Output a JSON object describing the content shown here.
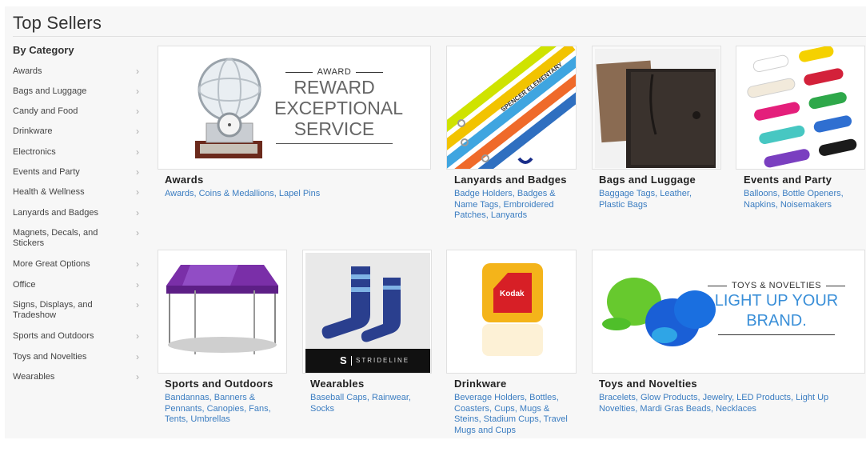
{
  "page": {
    "title": "Top Sellers"
  },
  "sidebar": {
    "heading": "By Category",
    "items": [
      {
        "label": "Awards"
      },
      {
        "label": "Bags and Luggage"
      },
      {
        "label": "Candy and Food"
      },
      {
        "label": "Drinkware"
      },
      {
        "label": "Electronics"
      },
      {
        "label": "Events and Party"
      },
      {
        "label": "Health & Wellness"
      },
      {
        "label": "Lanyards and Badges"
      },
      {
        "label": "Magnets, Decals, and Stickers"
      },
      {
        "label": "More Great Options"
      },
      {
        "label": "Office"
      },
      {
        "label": "Signs, Displays, and Tradeshow"
      },
      {
        "label": "Sports and Outdoors"
      },
      {
        "label": "Toys and Novelties"
      },
      {
        "label": "Wearables"
      }
    ],
    "chevron": "›"
  },
  "tiles": {
    "awards": {
      "title": "Awards",
      "links": "Awards, Coins & Medallions, Lapel Pins",
      "promo_kicker": "AWARD",
      "promo_line1": "REWARD",
      "promo_line2": "EXCEPTIONAL",
      "promo_line3": "SERVICE"
    },
    "lanyards": {
      "title": "Lanyards and Badges",
      "links": "Badge Holders, Badges & Name Tags, Embroidered Patches, Lanyards",
      "lanyard_text": "SPENCER ELEMENTARY"
    },
    "bags": {
      "title": "Bags and Luggage",
      "links": "Baggage Tags, Leather, Plastic Bags"
    },
    "events": {
      "title": "Events and Party",
      "links": "Balloons, Bottle Openers, Napkins, Noisemakers"
    },
    "sports": {
      "title": "Sports and Outdoors",
      "links": "Bandannas, Banners & Pennants, Canopies, Fans, Tents, Umbrellas"
    },
    "wearables": {
      "title": "Wearables",
      "links": "Baseball Caps, Rainwear, Socks",
      "brand_mark": "S",
      "brand_name": "STRIDELINE"
    },
    "drinkware": {
      "title": "Drinkware",
      "links": "Beverage Holders, Bottles, Coasters, Cups, Mugs & Steins, Stadium Cups, Travel Mugs and Cups",
      "logo_text": "Kodak"
    },
    "toys": {
      "title": "Toys and Novelties",
      "links": "Bracelets, Glow Products, Jewelry, LED Products, Light Up Novelties, Mardi Gras Beads, Necklaces",
      "promo_kicker": "TOYS & NOVELTIES",
      "promo_line1": "LIGHT UP YOUR",
      "promo_line2": "BRAND."
    }
  },
  "colors": {
    "link": "#3b7dc1",
    "toys_promo": "#3a8fd8",
    "kodak_red": "#d71f26",
    "kodak_yellow": "#f4b41a"
  }
}
